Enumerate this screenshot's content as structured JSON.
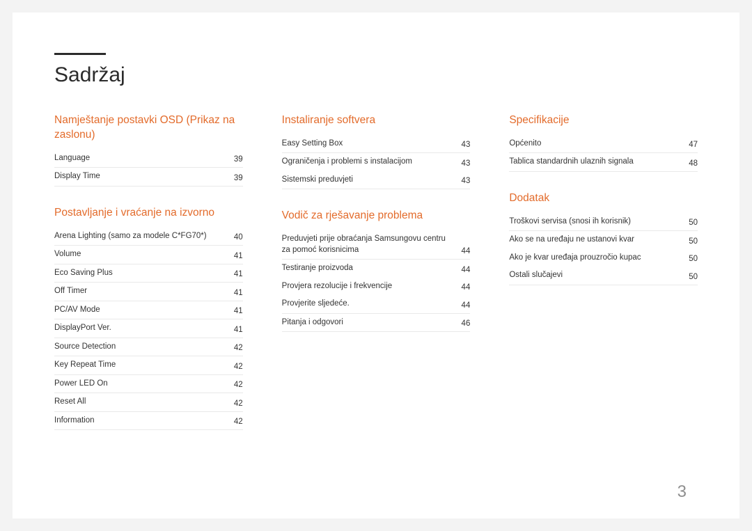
{
  "title": "Sadržaj",
  "page_number": "3",
  "columns": [
    {
      "sections": [
        {
          "heading": "Namještanje postavki OSD (Prikaz na zaslonu)",
          "entries": [
            {
              "label": "Language",
              "page": "39"
            },
            {
              "label": "Display Time",
              "page": "39"
            }
          ]
        },
        {
          "heading": "Postavljanje i vraćanje na izvorno",
          "entries": [
            {
              "label": "Arena Lighting (samo za modele C*FG70*)",
              "page": "40"
            },
            {
              "label": "Volume",
              "page": "41"
            },
            {
              "label": "Eco Saving Plus",
              "page": "41"
            },
            {
              "label": "Off Timer",
              "page": "41"
            },
            {
              "label": "PC/AV Mode",
              "page": "41"
            },
            {
              "label": "DisplayPort Ver.",
              "page": "41"
            },
            {
              "label": "Source Detection",
              "page": "42"
            },
            {
              "label": "Key Repeat Time",
              "page": "42"
            },
            {
              "label": "Power LED On",
              "page": "42"
            },
            {
              "label": "Reset All",
              "page": "42"
            },
            {
              "label": "Information",
              "page": "42"
            }
          ]
        }
      ]
    },
    {
      "sections": [
        {
          "heading": "Instaliranje softvera",
          "entries": [
            {
              "label": "Easy Setting Box",
              "page": "43"
            },
            {
              "label": "Ograničenja i problemi s instalacijom",
              "page": "43",
              "noborder": true
            },
            {
              "label": "Sistemski preduvjeti",
              "page": "43"
            }
          ]
        },
        {
          "heading": "Vodič za rješavanje problema",
          "entries": [
            {
              "label": "Preduvjeti prije obraćanja Samsungovu centru za pomoć korisnicima",
              "page": "44"
            },
            {
              "label": "Testiranje proizvoda",
              "page": "44",
              "noborder": true
            },
            {
              "label": "Provjera rezolucije i frekvencije",
              "page": "44",
              "noborder": true
            },
            {
              "label": "Provjerite sljedeće.",
              "page": "44"
            },
            {
              "label": "Pitanja i odgovori",
              "page": "46"
            }
          ]
        }
      ]
    },
    {
      "sections": [
        {
          "heading": "Specifikacije",
          "entries": [
            {
              "label": "Općenito",
              "page": "47"
            },
            {
              "label": "Tablica standardnih ulaznih signala",
              "page": "48"
            }
          ]
        },
        {
          "heading": "Dodatak",
          "entries": [
            {
              "label": "Troškovi servisa (snosi ih korisnik)",
              "page": "50"
            },
            {
              "label": "Ako se na uređaju ne ustanovi kvar",
              "page": "50",
              "noborder": true
            },
            {
              "label": "Ako je kvar uređaja prouzročio kupac",
              "page": "50",
              "noborder": true
            },
            {
              "label": "Ostali slučajevi",
              "page": "50"
            }
          ]
        }
      ]
    }
  ]
}
